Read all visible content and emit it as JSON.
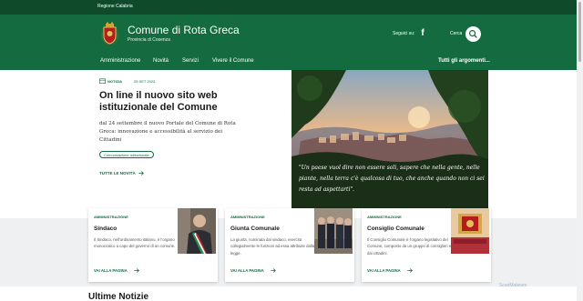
{
  "slim_header": {
    "region_link": "Regione Calabria"
  },
  "brand": {
    "title": "Comune di Rota Greca",
    "subtitle": "Provincia di Cosenza",
    "follow_label": "Seguici su:",
    "social_icon": "facebook-icon",
    "search_label": "Cerca",
    "search_icon": "search-icon"
  },
  "nav": {
    "items": [
      {
        "label": "Amministrazione"
      },
      {
        "label": "Novità"
      },
      {
        "label": "Servizi"
      },
      {
        "label": "Vivere il Comune"
      }
    ],
    "all_topics": "Tutti gli argomenti..."
  },
  "hero": {
    "category": "NOTIZIA",
    "date": "25 SET 2023",
    "title": "On line il nuovo sito web istituzionale del Comune",
    "description": "dal 24 settembre il nuovo Portale del Comune di Rota Greca: innovazione e accessibilità al servizio dei Cittadini",
    "tag": "Comunicazione istituzionale",
    "all_news": "TUTTE LE NOVITÀ",
    "quote": "\"Un paese vuol dire non essere soli, sapere che nella gente, nelle piante, nella terra c'è qualcosa di tuo, che anche quando non ci sei resta ad aspettarti\"."
  },
  "cards": [
    {
      "category": "AMMINISTRAZIONE",
      "title": "Sindaco",
      "text": "Il Sindaco, nell'ordinamento italiano, è l'organo monocratico a capo del governo di un comune.",
      "link": "VAI ALLA PAGINA"
    },
    {
      "category": "AMMINISTRAZIONE",
      "title": "Giunta Comunale",
      "text": "La giunta, nominata dal sindaco, esercita collegialmente le funzioni ad essa attribuite dalla legge.",
      "link": "VAI ALLA PAGINA"
    },
    {
      "category": "AMMINISTRAZIONE",
      "title": "Consiglio Comunale",
      "text": "Il Consiglio Comunale è l'organo legislativo del Comune, composto da un gruppo di consiglieri eletti dai cittadini.",
      "link": "VAI ALLA PAGINA"
    }
  ],
  "section": {
    "latest_news": "Ultime Notizie"
  },
  "watermark": "ScanMalware",
  "colors": {
    "brand_green": "#146b3f",
    "dark_green": "#0f4a2b",
    "band_gray": "#eef0f2"
  }
}
